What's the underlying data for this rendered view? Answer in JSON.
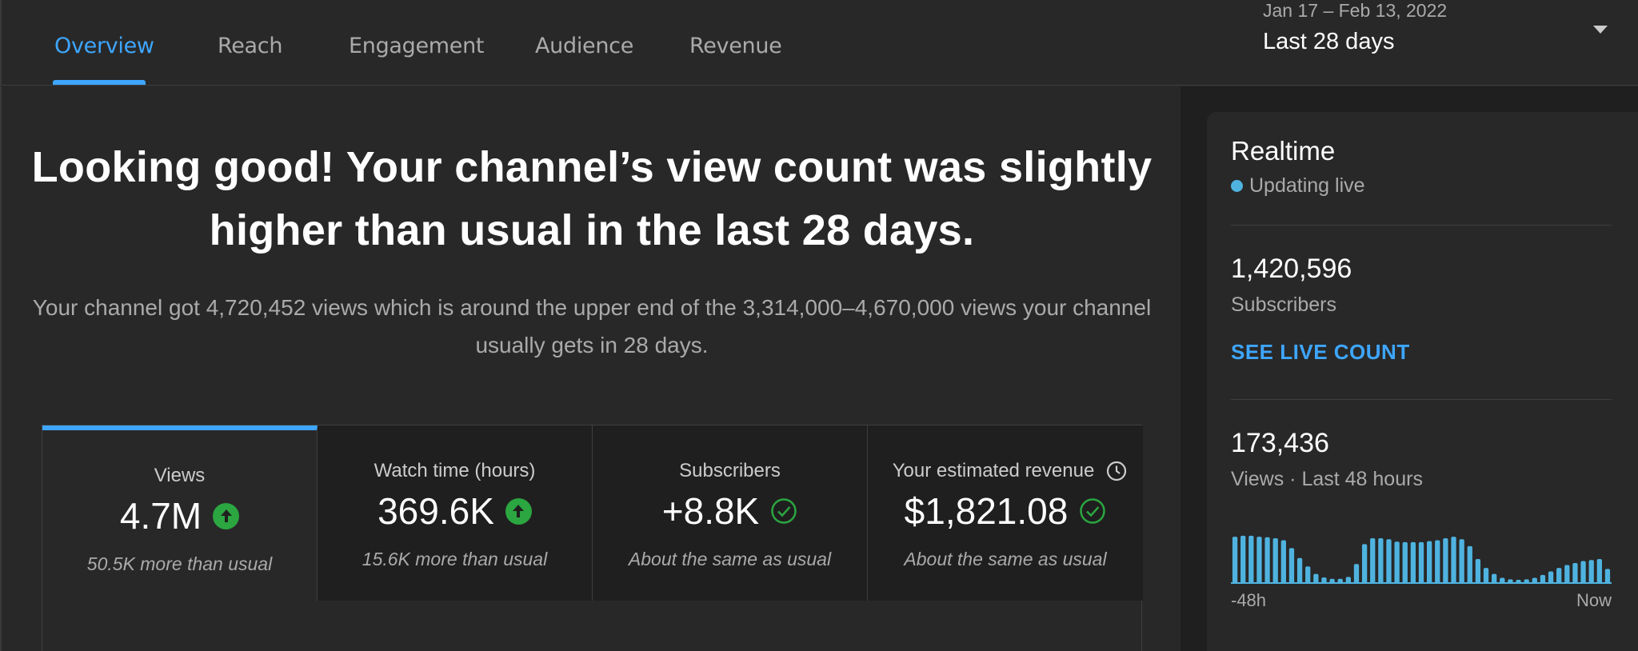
{
  "tabs": [
    {
      "label": "Overview",
      "active": true
    },
    {
      "label": "Reach",
      "active": false
    },
    {
      "label": "Engagement",
      "active": false
    },
    {
      "label": "Audience",
      "active": false
    },
    {
      "label": "Revenue",
      "active": false
    }
  ],
  "date_range": {
    "range": "Jan 17 – Feb 13, 2022",
    "label": "Last 28 days"
  },
  "headline": "Looking good! Your channel’s view count was slightly higher than usual in the last 28 days.",
  "subtext": "Your channel got 4,720,452 views which is around the upper end of the 3,314,000–4,670,000 views your channel usually gets in 28 days.",
  "cards": [
    {
      "label": "Views",
      "value": "4.7M",
      "note": "50.5K more than usual",
      "status": "up"
    },
    {
      "label": "Watch time (hours)",
      "value": "369.6K",
      "note": "15.6K more than usual",
      "status": "up"
    },
    {
      "label": "Subscribers",
      "value": "+8.8K",
      "note": "About the same as usual",
      "status": "same"
    },
    {
      "label": "Your estimated revenue",
      "value": "$1,821.08",
      "note": "About the same as usual",
      "status": "same"
    }
  ],
  "realtime": {
    "title": "Realtime",
    "live_label": "Updating live",
    "subscribers": "1,420,596",
    "subscribers_label": "Subscribers",
    "see_live_count": "SEE LIVE COUNT",
    "views": "173,436",
    "views_label": "Views · Last 48 hours",
    "axis_start": "-48h",
    "axis_end": "Now"
  },
  "chart_data": {
    "type": "bar",
    "values": [
      0.95,
      0.97,
      0.97,
      0.95,
      0.94,
      0.92,
      0.88,
      0.72,
      0.52,
      0.35,
      0.2,
      0.13,
      0.1,
      0.1,
      0.14,
      0.4,
      0.8,
      0.92,
      0.92,
      0.9,
      0.85,
      0.84,
      0.84,
      0.84,
      0.86,
      0.88,
      0.92,
      0.95,
      0.9,
      0.76,
      0.5,
      0.32,
      0.2,
      0.12,
      0.09,
      0.08,
      0.09,
      0.12,
      0.18,
      0.25,
      0.32,
      0.38,
      0.42,
      0.46,
      0.48,
      0.5,
      0.3
    ],
    "xlabel": "",
    "ylabel": "",
    "categories": [],
    "xrange": [
      "-48h",
      "Now"
    ]
  },
  "colors": {
    "accent": "#3ea6ff",
    "up_green": "#2ba640",
    "bar": "#4fb3e0"
  }
}
